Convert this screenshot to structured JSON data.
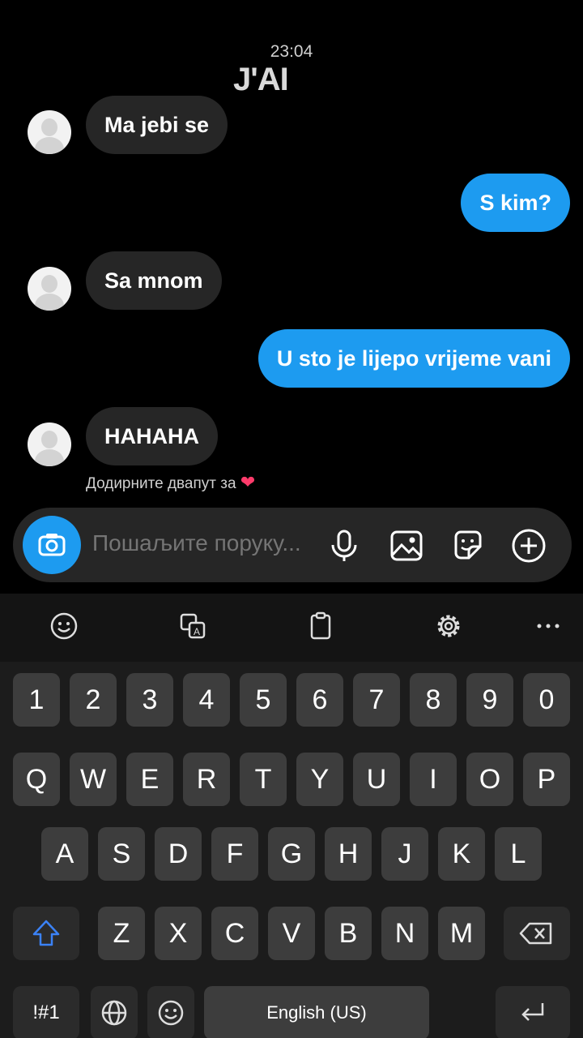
{
  "status": {
    "time": "23:04"
  },
  "overlay_text": "J'AI",
  "messages": [
    {
      "side": "in",
      "text": "Ma jebi se"
    },
    {
      "side": "out",
      "text": "S kim?"
    },
    {
      "side": "in",
      "text": "Sa mnom"
    },
    {
      "side": "out",
      "text": "U sto je lijepo vrijeme vani"
    },
    {
      "side": "in",
      "text": "HAHAHA"
    }
  ],
  "double_tap_hint": "Додирните двапут за",
  "composer": {
    "placeholder": "Пошаљите поруку...",
    "icons": [
      "camera-icon",
      "microphone-icon",
      "gallery-icon",
      "sticker-icon",
      "plus-icon"
    ]
  },
  "keyboard": {
    "toolbar_icons": [
      "emoji-icon",
      "translate-icon",
      "clipboard-icon",
      "settings-icon",
      "more-icon"
    ],
    "row_numbers": [
      "1",
      "2",
      "3",
      "4",
      "5",
      "6",
      "7",
      "8",
      "9",
      "0"
    ],
    "row_1": [
      "Q",
      "W",
      "E",
      "R",
      "T",
      "Y",
      "U",
      "I",
      "O",
      "P"
    ],
    "row_2": [
      "A",
      "S",
      "D",
      "F",
      "G",
      "H",
      "J",
      "K",
      "L"
    ],
    "row_3": [
      "Z",
      "X",
      "C",
      "V",
      "B",
      "N",
      "M"
    ],
    "symbols_label": "!#1",
    "space_label": "English (US)"
  },
  "colors": {
    "accent": "#1d9bf0",
    "incoming_bubble": "#262626",
    "heart": "#ff3b6b"
  }
}
